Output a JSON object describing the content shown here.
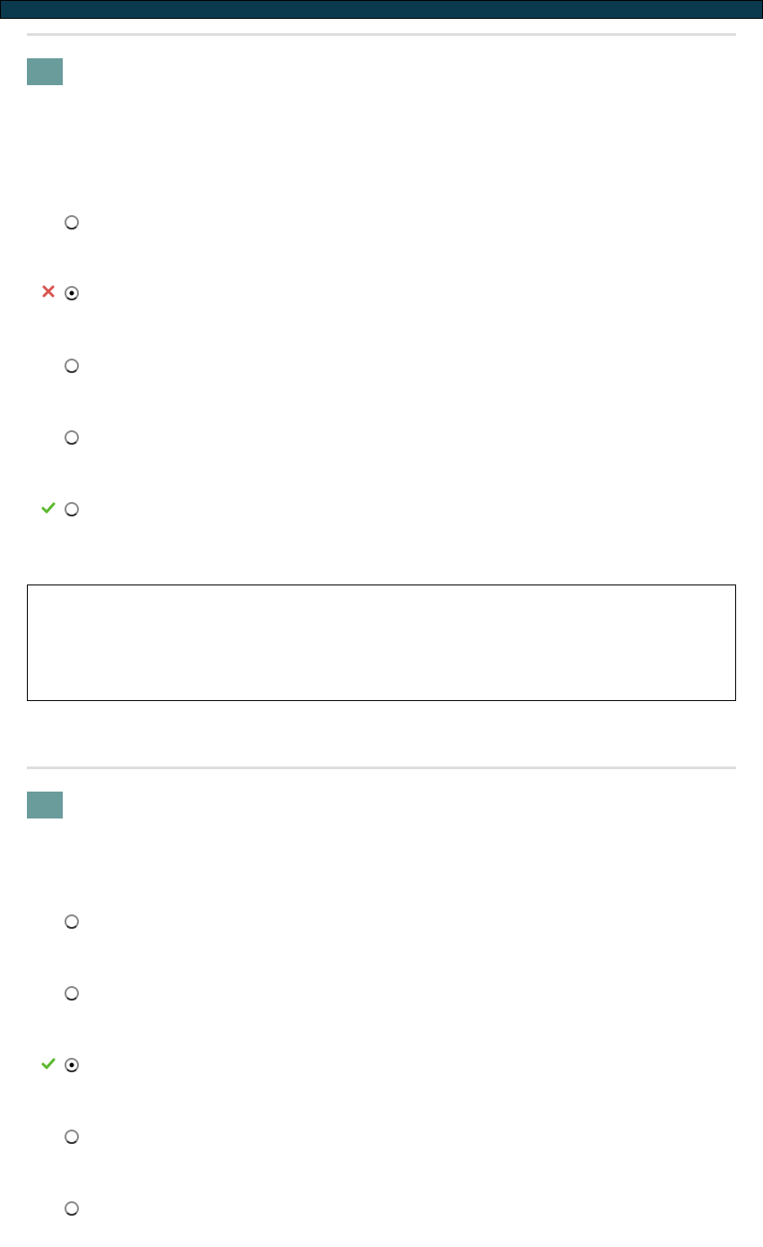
{
  "colors": {
    "topbar": "#0b3a4f",
    "qnum_bg": "#6a9c9c",
    "divider": "#dddddd",
    "wrong": "#d9534f",
    "correct": "#5cb82e"
  },
  "questions": [
    {
      "number": "",
      "text": "",
      "options": [
        {
          "label": "",
          "selected": false,
          "mark": "none"
        },
        {
          "label": "",
          "selected": true,
          "mark": "wrong"
        },
        {
          "label": "",
          "selected": false,
          "mark": "none"
        },
        {
          "label": "",
          "selected": false,
          "mark": "none"
        },
        {
          "label": "",
          "selected": false,
          "mark": "correct"
        }
      ],
      "feedback": ""
    },
    {
      "number": "",
      "text": "",
      "options": [
        {
          "label": "",
          "selected": false,
          "mark": "none"
        },
        {
          "label": "",
          "selected": false,
          "mark": "none"
        },
        {
          "label": "",
          "selected": true,
          "mark": "correct"
        },
        {
          "label": "",
          "selected": false,
          "mark": "none"
        },
        {
          "label": "",
          "selected": false,
          "mark": "none"
        }
      ]
    }
  ]
}
